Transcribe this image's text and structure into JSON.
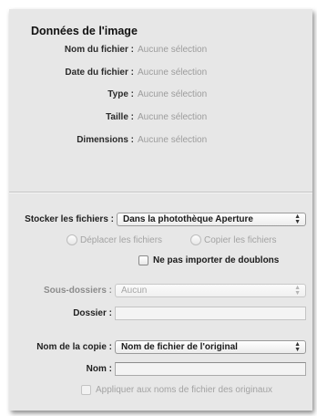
{
  "image_data": {
    "title": "Données de l'image",
    "rows": [
      {
        "label": "Nom du fichier :",
        "value": "Aucune sélection"
      },
      {
        "label": "Date du fichier :",
        "value": "Aucune sélection"
      },
      {
        "label": "Type :",
        "value": "Aucune sélection"
      },
      {
        "label": "Taille :",
        "value": "Aucune sélection"
      },
      {
        "label": "Dimensions :",
        "value": "Aucune sélection"
      }
    ]
  },
  "storage": {
    "label": "Stocker les fichiers :",
    "selected": "Dans la photothèque Aperture",
    "move_label": "Déplacer les fichiers",
    "copy_label": "Copier les fichiers",
    "no_duplicates_label": "Ne pas importer de doublons"
  },
  "subfolders": {
    "label": "Sous-dossiers :",
    "selected": "Aucun",
    "folder_label": "Dossier :",
    "folder_value": ""
  },
  "copy_name": {
    "label": "Nom de la copie :",
    "selected": "Nom de fichier de l'original",
    "name_label": "Nom :",
    "name_value": "",
    "apply_label": "Appliquer aux noms de fichier des originaux"
  }
}
